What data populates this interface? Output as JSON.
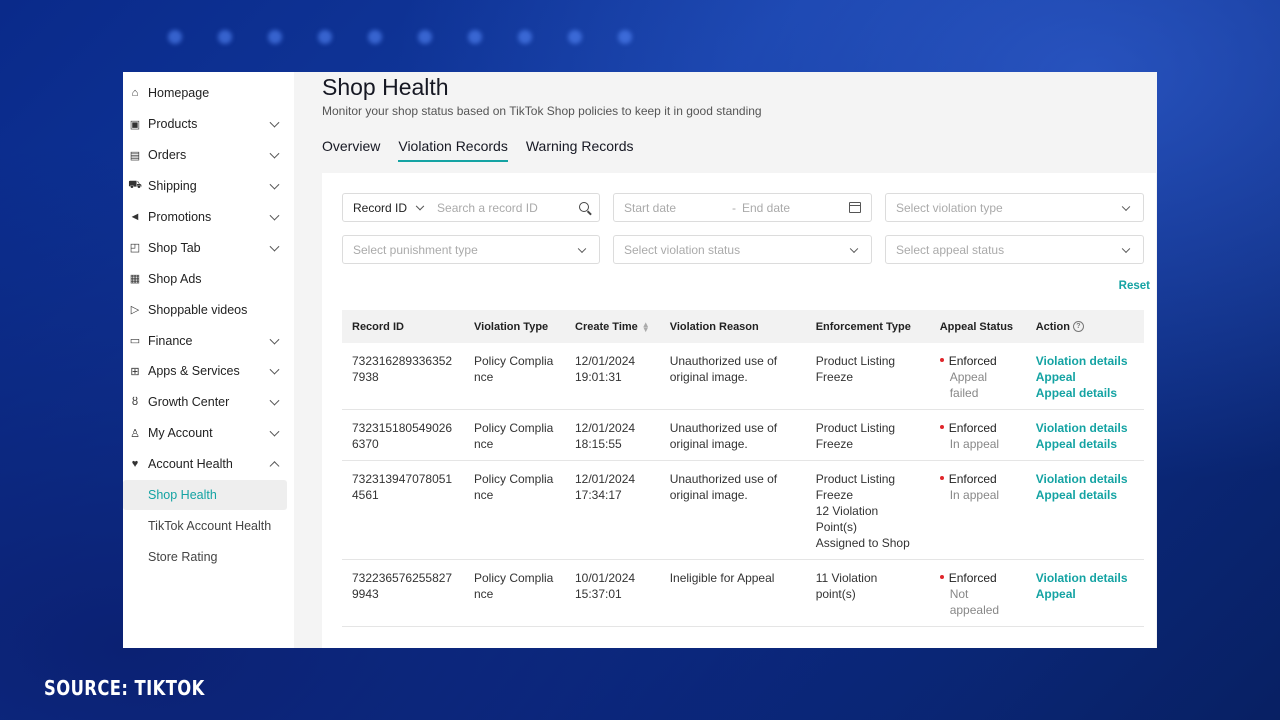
{
  "source_caption": "SOURCE: TIKTOK",
  "colors": {
    "accent": "#14a3a3",
    "enforced_dot": "#e0262b"
  },
  "sidebar": {
    "items": [
      {
        "label": "Homepage",
        "icon": "home-icon",
        "glyph": "⌂"
      },
      {
        "label": "Products",
        "icon": "box-icon",
        "glyph": "▣",
        "chevron": "down"
      },
      {
        "label": "Orders",
        "icon": "clipboard-icon",
        "glyph": "▤",
        "chevron": "down"
      },
      {
        "label": "Shipping",
        "icon": "truck-icon",
        "glyph": "⛟",
        "chevron": "down"
      },
      {
        "label": "Promotions",
        "icon": "megaphone-icon",
        "glyph": "◄",
        "chevron": "down"
      },
      {
        "label": "Shop Tab",
        "icon": "shopping-bag-icon",
        "glyph": "◰",
        "chevron": "down"
      },
      {
        "label": "Shop Ads",
        "icon": "ads-icon",
        "glyph": "▦"
      },
      {
        "label": "Shoppable videos",
        "icon": "video-icon",
        "glyph": "▷"
      },
      {
        "label": "Finance",
        "icon": "wallet-icon",
        "glyph": "▭",
        "chevron": "down"
      },
      {
        "label": "Apps & Services",
        "icon": "apps-icon",
        "glyph": "⊞",
        "chevron": "down"
      },
      {
        "label": "Growth Center",
        "icon": "medal-icon",
        "glyph": "ȣ",
        "chevron": "down"
      },
      {
        "label": "My Account",
        "icon": "user-icon",
        "glyph": "♙",
        "chevron": "down"
      },
      {
        "label": "Account Health",
        "icon": "heart-shield-icon",
        "glyph": "♥",
        "chevron": "up"
      }
    ],
    "sub_items": [
      "Shop Health",
      "TikTok Account Health",
      "Store Rating"
    ]
  },
  "page": {
    "title": "Shop Health",
    "subtitle": "Monitor your shop status based on TikTok Shop policies to keep it in good standing"
  },
  "tabs": [
    "Overview",
    "Violation Records",
    "Warning Records"
  ],
  "filters": {
    "record_id_label": "Record ID",
    "record_id_placeholder": "Search a record ID",
    "start_date": "Start date",
    "date_sep": "-",
    "end_date": "End date",
    "violation_type": "Select violation type",
    "punishment_type": "Select punishment type",
    "violation_status": "Select violation status",
    "appeal_status": "Select appeal status",
    "reset": "Reset"
  },
  "table": {
    "headers": [
      "Record ID",
      "Violation Type",
      "Create Time",
      "Violation Reason",
      "Enforcement Type",
      "Appeal Status",
      "Action"
    ],
    "rows": [
      {
        "id": [
          "732316289336352",
          "7938"
        ],
        "type": [
          "Policy Complia",
          "nce"
        ],
        "time": [
          "12/01/2024",
          "19:01:31"
        ],
        "reason": [
          "Unauthorized use of",
          "original image."
        ],
        "enforcement": [
          "Product Listing",
          "Freeze"
        ],
        "status": "Enforced",
        "status_sub": [
          "Appeal",
          "failed"
        ],
        "actions": [
          "Violation details",
          "Appeal",
          "Appeal details"
        ]
      },
      {
        "id": [
          "732315180549026",
          "6370"
        ],
        "type": [
          "Policy Complia",
          "nce"
        ],
        "time": [
          "12/01/2024",
          "18:15:55"
        ],
        "reason": [
          "Unauthorized use of",
          "original image."
        ],
        "enforcement": [
          "Product Listing",
          "Freeze"
        ],
        "status": "Enforced",
        "status_sub": [
          "In appeal"
        ],
        "actions": [
          "Violation details",
          "Appeal details"
        ]
      },
      {
        "id": [
          "732313947078051",
          "4561"
        ],
        "type": [
          "Policy Complia",
          "nce"
        ],
        "time": [
          "12/01/2024",
          "17:34:17"
        ],
        "reason": [
          "Unauthorized use of",
          "original image."
        ],
        "enforcement": [
          "Product Listing",
          "Freeze",
          "12 Violation Point(s)",
          "Assigned to Shop"
        ],
        "status": "Enforced",
        "status_sub": [
          "In appeal"
        ],
        "actions": [
          "Violation details",
          "Appeal details"
        ]
      },
      {
        "id": [
          "732236576255827",
          "9943"
        ],
        "type": [
          "Policy Complia",
          "nce"
        ],
        "time": [
          "10/01/2024",
          "15:37:01"
        ],
        "reason": [
          "Ineligible for Appeal"
        ],
        "enforcement": [
          "11 Violation point(s)"
        ],
        "status": "Enforced",
        "status_sub": [
          "Not",
          "appealed"
        ],
        "actions": [
          "Violation details",
          "Appeal"
        ]
      }
    ]
  }
}
